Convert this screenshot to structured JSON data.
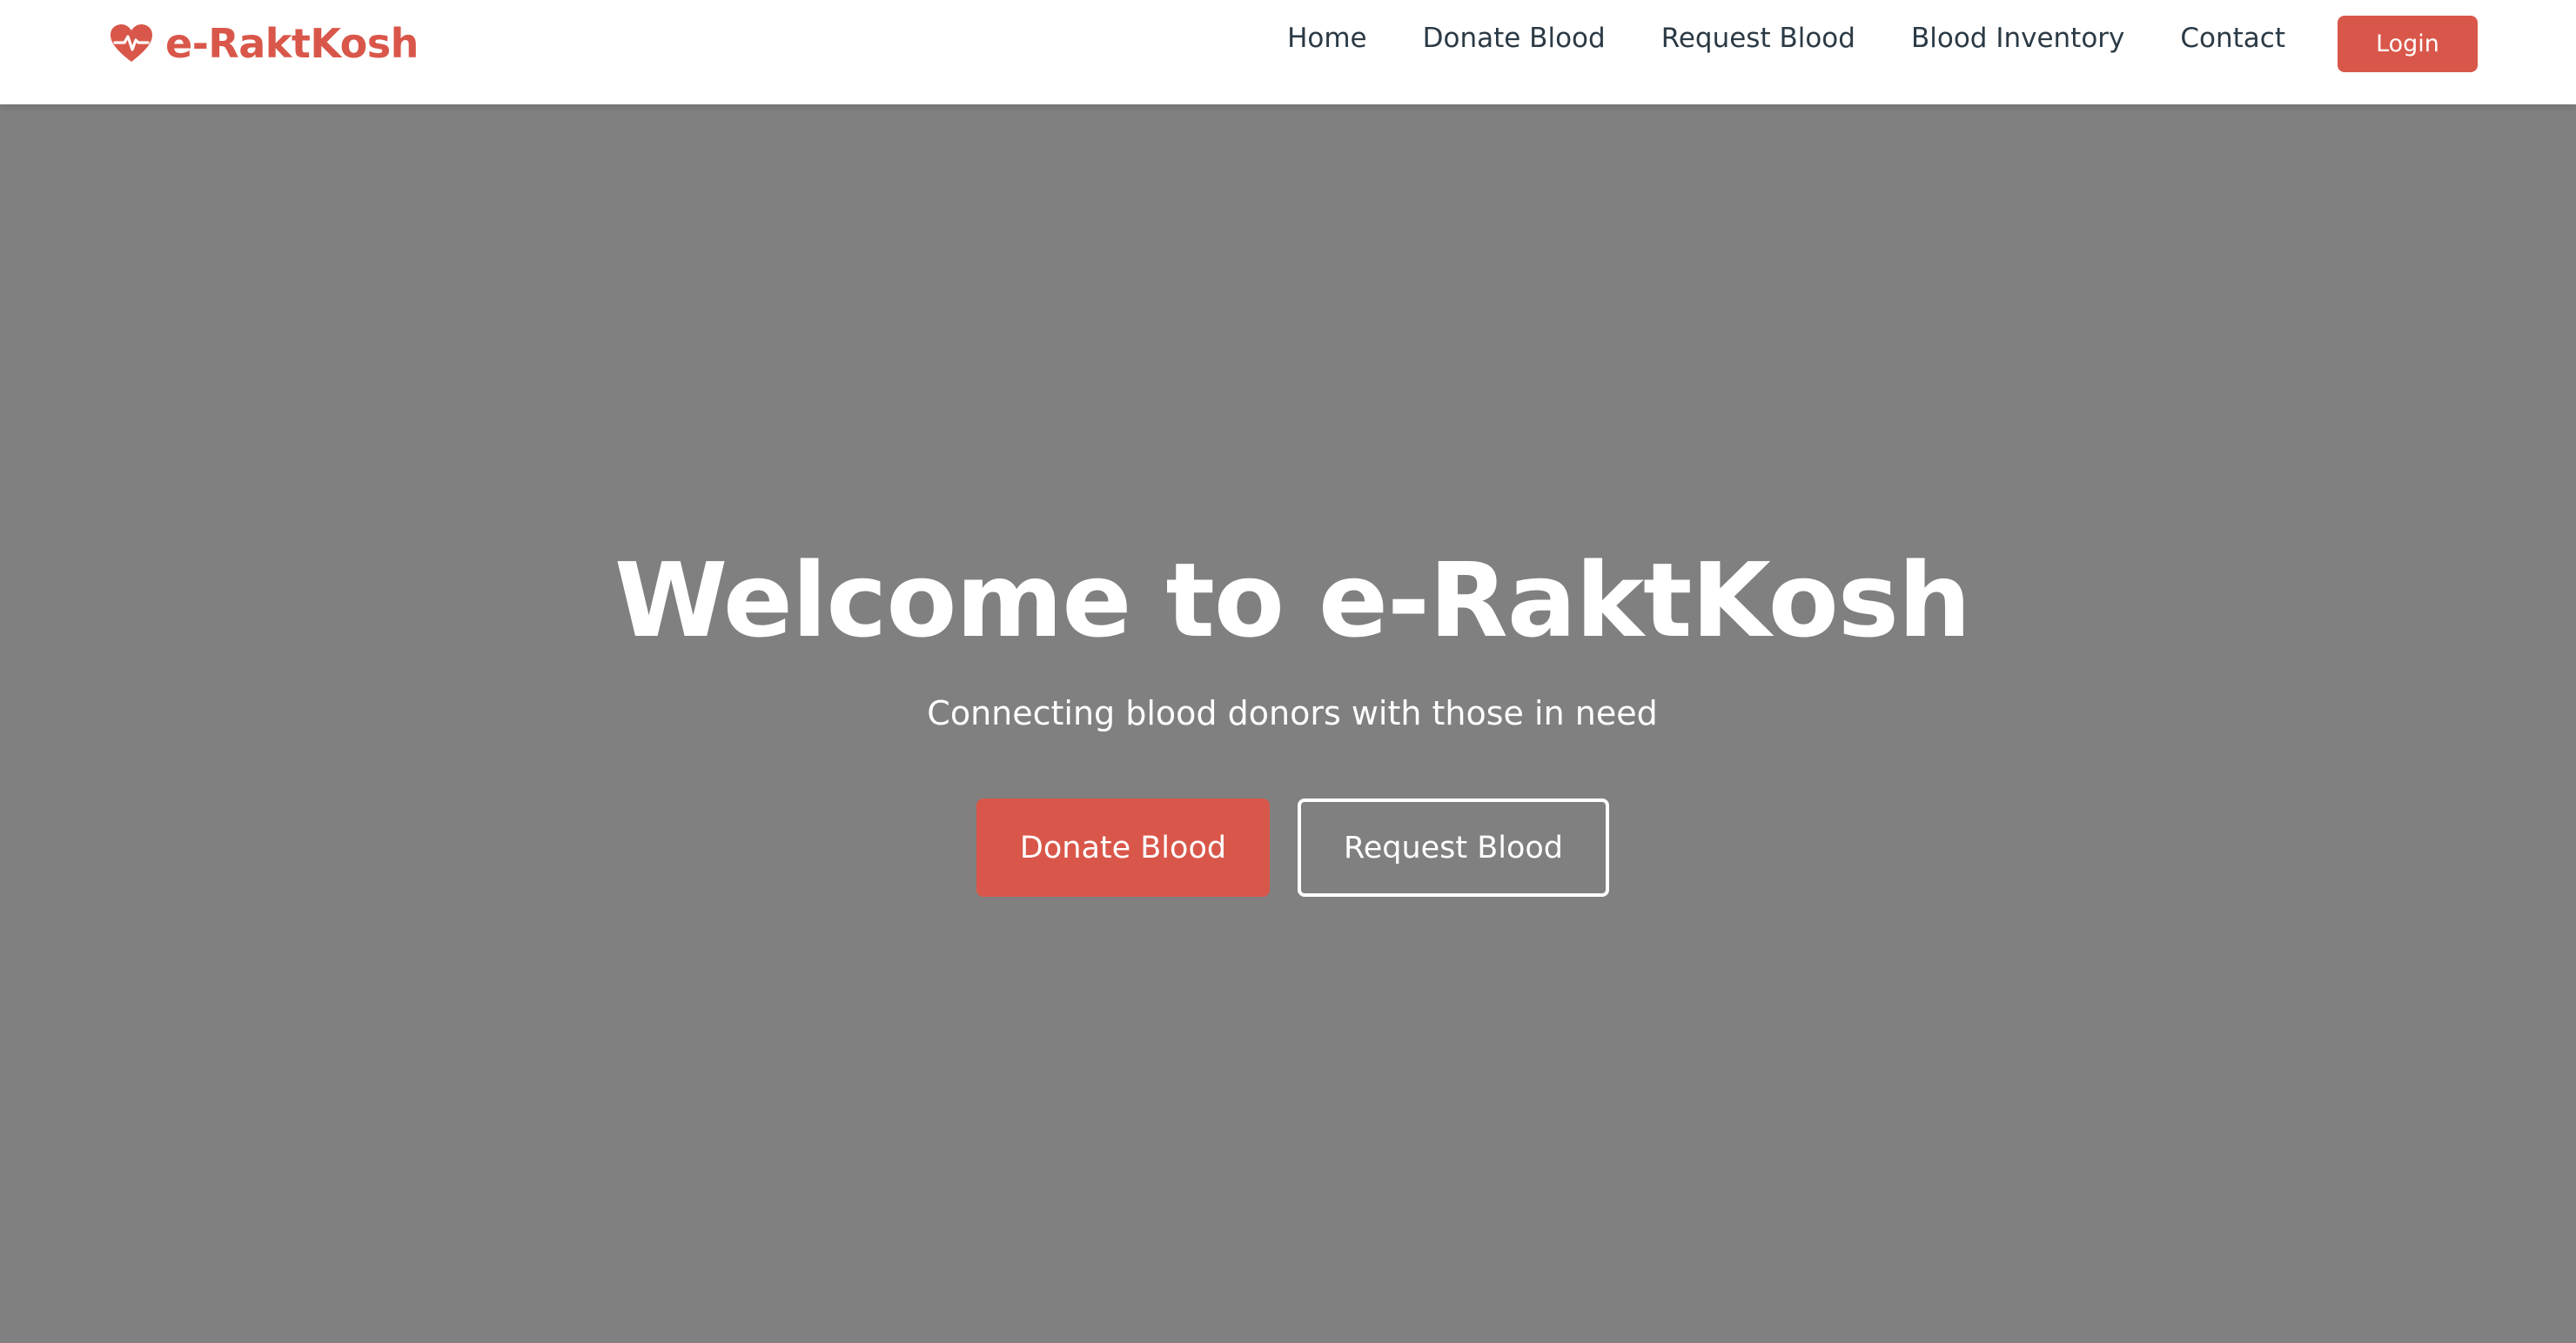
{
  "theme": {
    "accent": "#d9574a",
    "hero_overlay": "#808080",
    "nav_text": "#2b3a45"
  },
  "brand": {
    "icon": "heart-pulse-icon",
    "name": "e-RaktKosh"
  },
  "nav": {
    "items": [
      {
        "label": "Home"
      },
      {
        "label": "Donate Blood"
      },
      {
        "label": "Request Blood"
      },
      {
        "label": "Blood Inventory"
      },
      {
        "label": "Contact"
      }
    ],
    "login_label": "Login"
  },
  "hero": {
    "title": "Welcome to e-RaktKosh",
    "subtitle": "Connecting blood donors with those in need",
    "primary_cta": "Donate Blood",
    "secondary_cta": "Request Blood"
  }
}
